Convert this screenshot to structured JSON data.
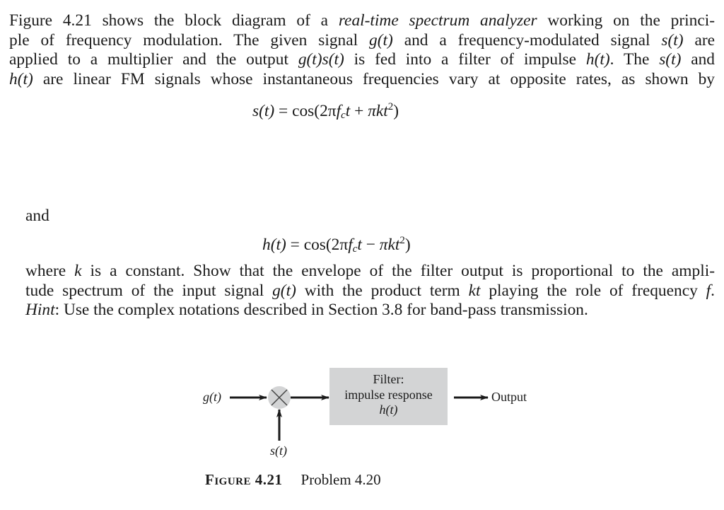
{
  "paragraph1": {
    "lines": [
      [
        "Figure 4.21 shows the block diagram of a ",
        "real-time spectrum analyzer",
        " working on the princi-"
      ],
      [
        "ple of frequency modulation. The given signal ",
        "g(t)",
        " and a frequency-modulated signal ",
        "s(t)",
        " are"
      ],
      [
        "applied to a multiplier and the output ",
        "g(t)s(t)",
        " is fed into a filter of impulse ",
        "h(t)",
        ". The ",
        "s(t)",
        " and"
      ],
      [
        "h(t)",
        " are linear FM signals whose instantaneous frequencies vary at opposite rates, as shown by"
      ]
    ]
  },
  "equation1": {
    "lhs": "s(t)",
    "equals": "=",
    "func": "cos(2π",
    "f": "f",
    "sub": "c",
    "t": "t",
    "op": "+",
    "term": "πkt",
    "sup": "2",
    "close": ")"
  },
  "and_word": "and",
  "equation2": {
    "lhs": "h(t)",
    "equals": "=",
    "func": "cos(2π",
    "f": "f",
    "sub": "c",
    "t": "t",
    "op": "−",
    "term": "πkt",
    "sup": "2",
    "close": ")"
  },
  "paragraph2": {
    "lines": [
      [
        "where ",
        "k",
        " is a constant. Show that the envelope of the filter output is proportional to the ampli-"
      ],
      [
        "tude spectrum of the input signal ",
        "g(t)",
        " with the product term ",
        "kt",
        " playing the role of frequency ",
        "f",
        "."
      ],
      [
        "Hint",
        ": Use the complex notations described in Section 3.8 for band-pass transmission."
      ]
    ]
  },
  "diagram": {
    "input_label": "g(t)",
    "multiplier_symbol": "×",
    "second_input_label": "s(t)",
    "filter_title": "Filter:",
    "filter_line2": "impulse response",
    "filter_line3": "h(t)",
    "output_label": "Output",
    "filter_fill": "#d3d4d5",
    "multiplier_fill": "#d3d4d5"
  },
  "caption": {
    "figure_label": "Figure 4.21",
    "title": "Problem 4.20"
  }
}
